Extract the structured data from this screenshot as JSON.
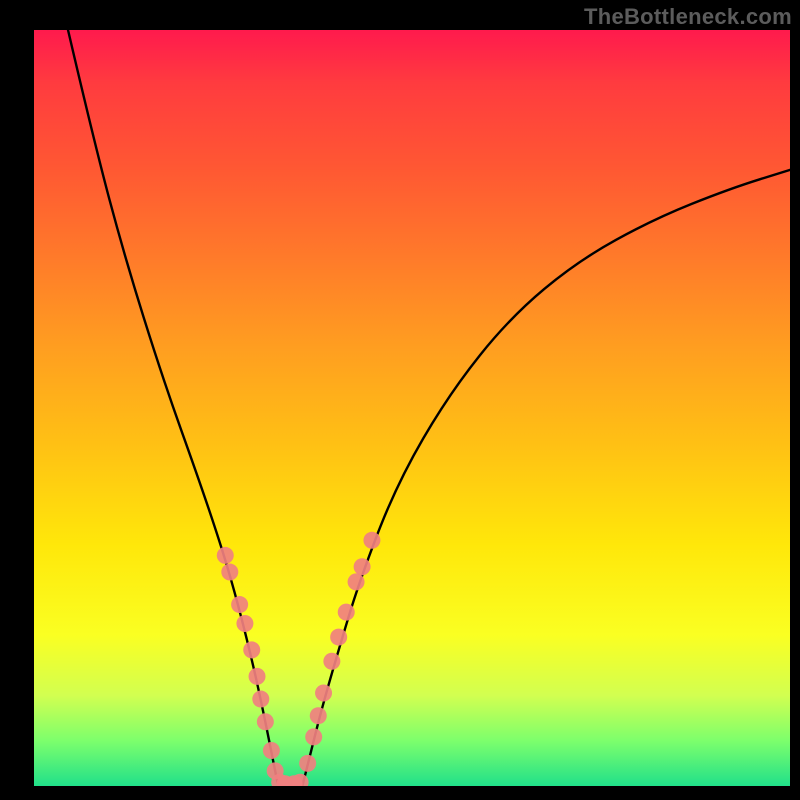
{
  "watermark": "TheBottleneck.com",
  "chart_data": {
    "type": "line",
    "title": "",
    "xlabel": "",
    "ylabel": "",
    "xlim": [
      0,
      100
    ],
    "ylim": [
      0,
      100
    ],
    "background_gradient": [
      "#ff1a4d",
      "#ff5733",
      "#ff9e20",
      "#ffe70a",
      "#d2ff50",
      "#21e08a"
    ],
    "series": [
      {
        "name": "left-curve",
        "x": [
          4.5,
          8,
          12,
          17,
          22,
          25,
          27,
          29,
          30.5,
          31.5,
          32.3
        ],
        "y": [
          100,
          85,
          70,
          54,
          40,
          31,
          24,
          16,
          9,
          4,
          0
        ],
        "color": "#000000"
      },
      {
        "name": "right-curve",
        "x": [
          35.5,
          36.5,
          38,
          40,
          43,
          48,
          55,
          63,
          72,
          82,
          92,
          100
        ],
        "y": [
          0,
          4,
          10,
          17,
          27,
          40,
          52,
          62,
          69.5,
          75,
          79,
          81.5
        ],
        "color": "#000000"
      },
      {
        "name": "valley-floor",
        "x": [
          32.3,
          35.5
        ],
        "y": [
          0,
          0
        ],
        "color": "#000000"
      }
    ],
    "scatter": [
      {
        "name": "left-dots",
        "color": "#f08080",
        "r": 8.5,
        "points": [
          {
            "x": 25.3,
            "y": 30.5
          },
          {
            "x": 25.9,
            "y": 28.3
          },
          {
            "x": 27.2,
            "y": 24.0
          },
          {
            "x": 27.9,
            "y": 21.5
          },
          {
            "x": 28.8,
            "y": 18.0
          },
          {
            "x": 29.5,
            "y": 14.5
          },
          {
            "x": 30.0,
            "y": 11.5
          },
          {
            "x": 30.6,
            "y": 8.5
          },
          {
            "x": 31.4,
            "y": 4.7
          },
          {
            "x": 31.9,
            "y": 2.0
          },
          {
            "x": 32.5,
            "y": 0.5
          },
          {
            "x": 33.2,
            "y": 0.3
          },
          {
            "x": 34.4,
            "y": 0.3
          },
          {
            "x": 35.2,
            "y": 0.5
          }
        ]
      },
      {
        "name": "right-dots",
        "color": "#f08080",
        "r": 8.5,
        "points": [
          {
            "x": 36.2,
            "y": 3.0
          },
          {
            "x": 37.0,
            "y": 6.5
          },
          {
            "x": 37.6,
            "y": 9.3
          },
          {
            "x": 38.3,
            "y": 12.3
          },
          {
            "x": 39.4,
            "y": 16.5
          },
          {
            "x": 40.3,
            "y": 19.7
          },
          {
            "x": 41.3,
            "y": 23.0
          },
          {
            "x": 42.6,
            "y": 27.0
          },
          {
            "x": 43.4,
            "y": 29.0
          },
          {
            "x": 44.7,
            "y": 32.5
          }
        ]
      }
    ]
  }
}
